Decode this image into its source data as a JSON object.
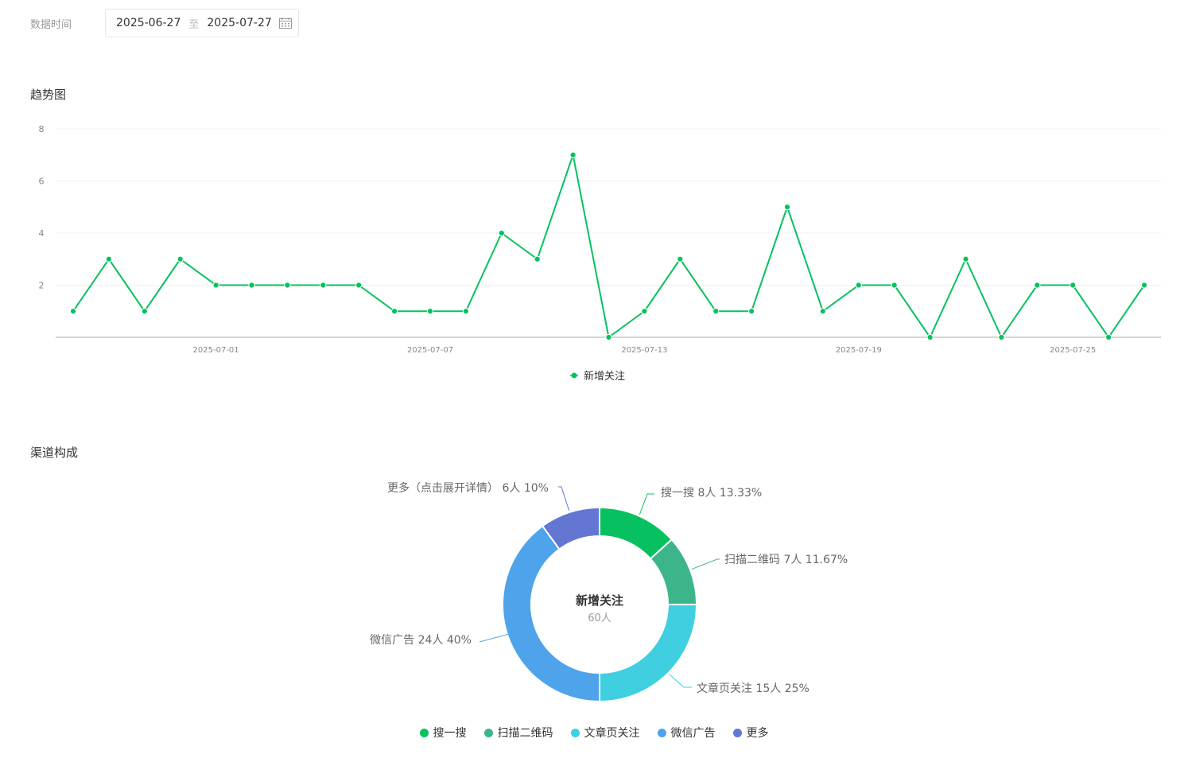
{
  "filter": {
    "label": "数据时间",
    "start_date": "2025-06-27",
    "separator": "至",
    "end_date": "2025-07-27"
  },
  "trend": {
    "title": "趋势图"
  },
  "channel": {
    "title": "渠道构成"
  },
  "colors": {
    "line": "#07c160",
    "pie": [
      "#07c160",
      "#3cb58b",
      "#40cfe0",
      "#4ea3ea",
      "#6276d2"
    ]
  },
  "chart_data": [
    {
      "type": "line",
      "title": "",
      "x": [
        "2025-06-27",
        "2025-06-28",
        "2025-06-29",
        "2025-06-30",
        "2025-07-01",
        "2025-07-02",
        "2025-07-03",
        "2025-07-04",
        "2025-07-05",
        "2025-07-06",
        "2025-07-07",
        "2025-07-08",
        "2025-07-09",
        "2025-07-10",
        "2025-07-11",
        "2025-07-12",
        "2025-07-13",
        "2025-07-14",
        "2025-07-15",
        "2025-07-16",
        "2025-07-17",
        "2025-07-18",
        "2025-07-19",
        "2025-07-20",
        "2025-07-21",
        "2025-07-22",
        "2025-07-23",
        "2025-07-24",
        "2025-07-25",
        "2025-07-26",
        "2025-07-27"
      ],
      "series": [
        {
          "name": "新增关注",
          "values": [
            1,
            3,
            1,
            3,
            2,
            2,
            2,
            2,
            2,
            1,
            1,
            1,
            4,
            3,
            7,
            0,
            1,
            3,
            1,
            1,
            5,
            1,
            2,
            2,
            0,
            3,
            0,
            2,
            2,
            0,
            2
          ]
        }
      ],
      "x_tick_labels": [
        "2025-07-01",
        "2025-07-07",
        "2025-07-13",
        "2025-07-19",
        "2025-07-25"
      ],
      "y_ticks": [
        "2",
        "4",
        "6",
        "8"
      ],
      "ylim": [
        0,
        8
      ],
      "grid": true,
      "legend": "bottom-center"
    },
    {
      "type": "pie",
      "variant": "donut",
      "center_title": "新增关注",
      "center_value": "60人",
      "slices": [
        {
          "name": "搜一搜",
          "value": 8,
          "label": "搜一搜 8人 13.33%"
        },
        {
          "name": "扫描二维码",
          "value": 7,
          "label": "扫描二维码 7人 11.67%"
        },
        {
          "name": "文章页关注",
          "value": 15,
          "label": "文章页关注 15人 25%"
        },
        {
          "name": "微信广告",
          "value": 24,
          "label": "微信广告 24人 40%"
        },
        {
          "name": "更多",
          "value": 6,
          "label": "更多（点击展开详情） 6人 10%"
        }
      ],
      "legend": [
        "搜一搜",
        "扫描二维码",
        "文章页关注",
        "微信广告",
        "更多"
      ]
    }
  ]
}
